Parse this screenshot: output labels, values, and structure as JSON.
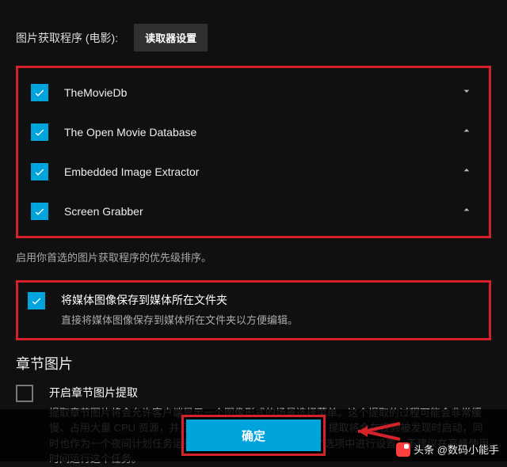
{
  "label_row": {
    "label": "图片获取程序 (电影):",
    "button": "读取器设置"
  },
  "fetchers": [
    {
      "name": "TheMovieDb",
      "checked": true,
      "expanded": false
    },
    {
      "name": "The Open Movie Database",
      "checked": true,
      "expanded": true
    },
    {
      "name": "Embedded Image Extractor",
      "checked": true,
      "expanded": true
    },
    {
      "name": "Screen Grabber",
      "checked": true,
      "expanded": true
    }
  ],
  "hint": "启用你首选的图片获取程序的优先级排序。",
  "save_opt": {
    "title": "将媒体图像保存到媒体所在文件夹",
    "desc": "直接将媒体图像保存到媒体所在文件夹以方便编辑。"
  },
  "chapter": {
    "heading": "章节图片",
    "title": "开启章节图片提取",
    "desc": "提取章节图片将会允许客户端显示一个图像形式的场景选择菜单。这个提取的过程可能会非常缓慢、占用大量 CPU 资源，并且可能需要几个GB的硬盘空间。提取将会在视频被发现时启动，同时也作为一个夜间计划任务运行。这个任务可以在\"计划任务\"选项中进行设置。不建议在高峰使用时间运行这个任务。"
  },
  "footer": {
    "ok": "确定"
  },
  "watermark": "@数码小能手"
}
